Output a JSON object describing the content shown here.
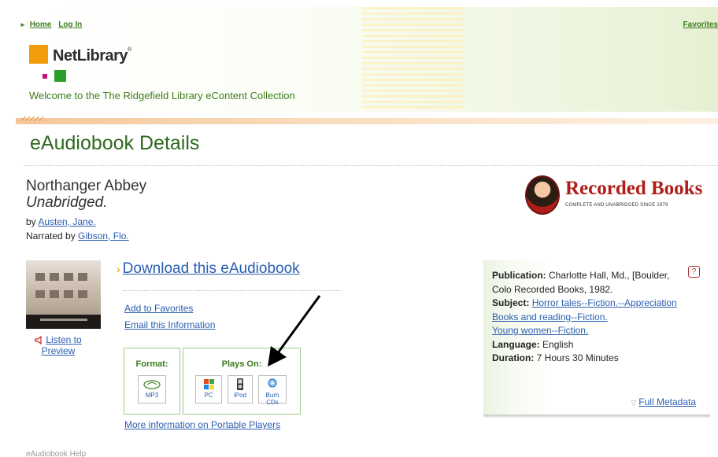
{
  "header": {
    "nav": [
      "Home",
      "Log In"
    ],
    "favorites": "Favorites",
    "logo_text": "NetLibrary",
    "welcome": "Welcome to the The Ridgefield Library eContent Collection"
  },
  "page": {
    "title": "eAudiobook Details"
  },
  "book": {
    "title": "Northanger Abbey",
    "edition": "Unabridged.",
    "by_prefix": "by",
    "author": "Austen, Jane.",
    "narrated_prefix": "Narrated by",
    "narrator": "Gibson, Flo.",
    "listen_label": "Listen to Preview"
  },
  "publisher": {
    "name": "Recorded Books",
    "tagline": "COMPLETE AND UNABRIDGED SINCE 1979"
  },
  "actions": {
    "download": "Download this eAudiobook",
    "add_favorites": "Add to Favorites",
    "email": "Email this Information",
    "more_info": "More information on Portable Players"
  },
  "formats": {
    "format_label": "Format:",
    "plays_label": "Plays On:",
    "format_items": [
      {
        "name": "MP3",
        "icon": "mp3-icon"
      }
    ],
    "player_items": [
      {
        "name": "PC",
        "icon": "windows-pc-icon"
      },
      {
        "name": "iPod",
        "icon": "ipod-icon"
      },
      {
        "name": "Burn CDs",
        "icon": "burn-cd-icon"
      }
    ]
  },
  "metadata": {
    "publication_label": "Publication:",
    "publication": "Charlotte Hall, Md., [Boulder, Colo Recorded Books, 1982.",
    "subject_label": "Subject:",
    "subjects": [
      "Horror tales--Fiction.--Appreciation",
      "Books and reading--Fiction.",
      "Young women--Fiction."
    ],
    "language_label": "Language:",
    "language": "English",
    "duration_label": "Duration:",
    "duration": "7 Hours 30 Minutes",
    "full_metadata": "Full Metadata"
  },
  "footer": {
    "hint": "eAudiobook Help"
  },
  "colors": {
    "accent_green": "#3c7c1c",
    "title_green": "#2d6a1e",
    "link_blue": "#2a5db0",
    "logo_orange": "#f39c0c",
    "publisher_red": "#b01d18"
  }
}
